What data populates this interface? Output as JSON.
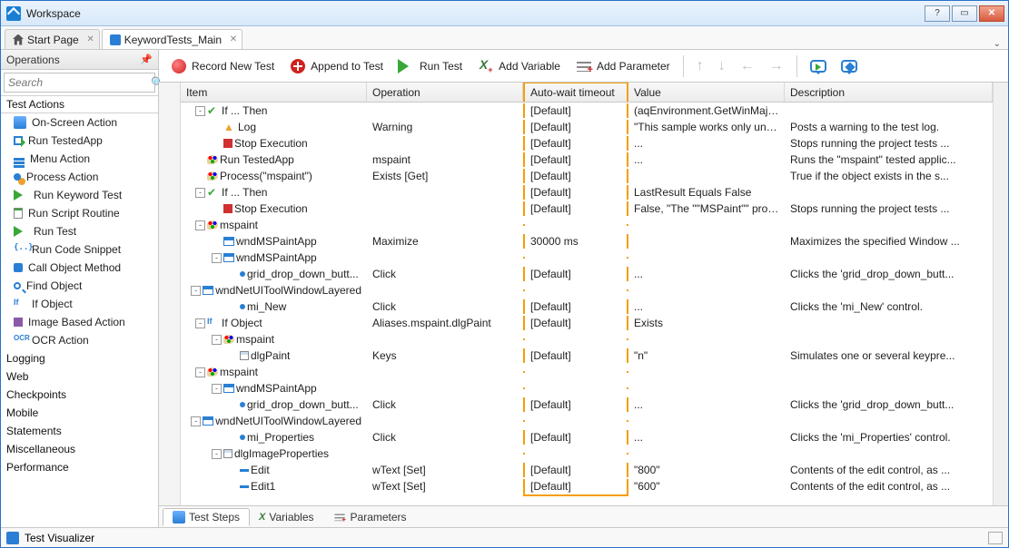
{
  "window": {
    "title": "Workspace"
  },
  "tabs": [
    {
      "label": "Start Page",
      "active": false,
      "icon": "home"
    },
    {
      "label": "KeywordTests_Main",
      "active": true,
      "icon": "kw"
    }
  ],
  "operations_panel": {
    "title": "Operations",
    "search_placeholder": "Search",
    "categories": [
      {
        "label": "Test Actions",
        "expanded": true,
        "selected": true
      },
      {
        "label": "Logging"
      },
      {
        "label": "Web"
      },
      {
        "label": "Checkpoints"
      },
      {
        "label": "Mobile"
      },
      {
        "label": "Statements"
      },
      {
        "label": "Miscellaneous"
      },
      {
        "label": "Performance"
      }
    ],
    "items": [
      {
        "label": "On-Screen Action",
        "icon": "i-onscreen"
      },
      {
        "label": "Run TestedApp",
        "icon": "i-runapp"
      },
      {
        "label": "Menu Action",
        "icon": "i-menu"
      },
      {
        "label": "Process Action",
        "icon": "i-process"
      },
      {
        "label": "Run Keyword Test",
        "icon": "i-playkw"
      },
      {
        "label": "Run Script Routine",
        "icon": "i-script"
      },
      {
        "label": "Run Test",
        "icon": "i-playtest"
      },
      {
        "label": "Run Code Snippet",
        "icon": "i-code",
        "textIcon": "{..}"
      },
      {
        "label": "Call Object Method",
        "icon": "i-call"
      },
      {
        "label": "Find Object",
        "icon": "i-find"
      },
      {
        "label": "If Object",
        "icon": "i-if",
        "textIcon": "If"
      },
      {
        "label": "Image Based Action",
        "icon": "i-img"
      },
      {
        "label": "OCR Action",
        "icon": "i-ocr",
        "textIcon": "OCR"
      }
    ]
  },
  "toolbar": {
    "record": "Record New Test",
    "append": "Append to Test",
    "run": "Run Test",
    "addvar": "Add Variable",
    "addparam": "Add Parameter"
  },
  "grid": {
    "headers": {
      "item": "Item",
      "operation": "Operation",
      "wait": "Auto-wait timeout",
      "value": "Value",
      "desc": "Description"
    },
    "rows": [
      {
        "indent": 0,
        "exp": "-",
        "icon": "i-green-check",
        "text": "If ... Then",
        "op": "",
        "wait": "[Default]",
        "val": "(aqEnvironment.GetWinMajorVe...",
        "desc": ""
      },
      {
        "indent": 1,
        "icon": "i-warn",
        "text": "Log",
        "op": "Warning",
        "wait": "[Default]",
        "val": "\"This sample works only under ...",
        "desc": "Posts a warning to the test log."
      },
      {
        "indent": 1,
        "icon": "i-stop",
        "text": "Stop Execution",
        "op": "",
        "wait": "[Default]",
        "val": "...",
        "desc": "Stops running the project tests ..."
      },
      {
        "indent": 0,
        "icon": "i-palette",
        "text": "Run TestedApp",
        "op": "mspaint",
        "wait": "[Default]",
        "val": "...",
        "desc": "Runs the \"mspaint\" tested applic..."
      },
      {
        "indent": 0,
        "icon": "i-palette",
        "text": "Process(\"mspaint\")",
        "op": "Exists [Get]",
        "wait": "[Default]",
        "val": "",
        "desc": "True if the object exists in the s..."
      },
      {
        "indent": 0,
        "exp": "-",
        "icon": "i-green-check",
        "text": "If ... Then",
        "op": "",
        "wait": "[Default]",
        "val": "LastResult Equals False",
        "desc": ""
      },
      {
        "indent": 1,
        "icon": "i-stop",
        "text": "Stop Execution",
        "op": "",
        "wait": "[Default]",
        "val": "False, \"The \"\"MSPaint\"\" process ...",
        "desc": "Stops running the project tests ..."
      },
      {
        "indent": 0,
        "exp": "-",
        "icon": "i-palette",
        "text": "mspaint",
        "op": "",
        "wait": "",
        "val": "",
        "desc": ""
      },
      {
        "indent": 1,
        "icon": "i-window",
        "text": "wndMSPaintApp",
        "op": "Maximize",
        "wait": "30000 ms",
        "val": "",
        "desc": "Maximizes the specified Window ..."
      },
      {
        "indent": 1,
        "exp": "-",
        "icon": "i-window",
        "text": "wndMSPaintApp",
        "op": "",
        "wait": "",
        "val": "",
        "desc": ""
      },
      {
        "indent": 2,
        "icon": "i-node",
        "text": "grid_drop_down_butt...",
        "op": "Click",
        "wait": "[Default]",
        "val": "...",
        "desc": "Clicks the 'grid_drop_down_butt..."
      },
      {
        "indent": 1,
        "exp": "-",
        "icon": "i-window",
        "text": "wndNetUIToolWindowLayered",
        "op": "",
        "wait": "",
        "val": "",
        "desc": ""
      },
      {
        "indent": 2,
        "icon": "i-node",
        "text": "mi_New",
        "op": "Click",
        "wait": "[Default]",
        "val": "...",
        "desc": "Clicks the 'mi_New' control."
      },
      {
        "indent": 0,
        "exp": "-",
        "icon": "i-if",
        "textIcon": "If",
        "text": "If Object",
        "op": "Aliases.mspaint.dlgPaint",
        "wait": "[Default]",
        "val": "Exists",
        "desc": ""
      },
      {
        "indent": 1,
        "exp": "-",
        "icon": "i-palette",
        "text": "mspaint",
        "op": "",
        "wait": "",
        "val": "",
        "desc": ""
      },
      {
        "indent": 2,
        "icon": "i-dlg",
        "text": "dlgPaint",
        "op": "Keys",
        "wait": "[Default]",
        "val": "\"n\"",
        "desc": "Simulates one or several keypre..."
      },
      {
        "indent": 0,
        "exp": "-",
        "icon": "i-palette",
        "text": "mspaint",
        "op": "",
        "wait": "",
        "val": "",
        "desc": ""
      },
      {
        "indent": 1,
        "exp": "-",
        "icon": "i-window",
        "text": "wndMSPaintApp",
        "op": "",
        "wait": "",
        "val": "",
        "desc": ""
      },
      {
        "indent": 2,
        "icon": "i-node",
        "text": "grid_drop_down_butt...",
        "op": "Click",
        "wait": "[Default]",
        "val": "...",
        "desc": "Clicks the 'grid_drop_down_butt..."
      },
      {
        "indent": 1,
        "exp": "-",
        "icon": "i-window",
        "text": "wndNetUIToolWindowLayered",
        "op": "",
        "wait": "",
        "val": "",
        "desc": ""
      },
      {
        "indent": 2,
        "icon": "i-node",
        "text": "mi_Properties",
        "op": "Click",
        "wait": "[Default]",
        "val": "...",
        "desc": "Clicks the 'mi_Properties' control."
      },
      {
        "indent": 1,
        "exp": "-",
        "icon": "i-dlg",
        "text": "dlgImageProperties",
        "op": "",
        "wait": "",
        "val": "",
        "desc": ""
      },
      {
        "indent": 2,
        "icon": "i-edit",
        "text": "Edit",
        "op": "wText [Set]",
        "wait": "[Default]",
        "val": "\"800\"",
        "desc": "Contents of the edit control, as ..."
      },
      {
        "indent": 2,
        "icon": "i-edit",
        "text": "Edit1",
        "op": "wText [Set]",
        "wait": "[Default]",
        "val": "\"600\"",
        "desc": "Contents of the edit control, as ..."
      }
    ]
  },
  "bottom_tabs": {
    "steps": "Test Steps",
    "vars": "Variables",
    "params": "Parameters"
  },
  "footer": {
    "visualizer": "Test Visualizer"
  }
}
